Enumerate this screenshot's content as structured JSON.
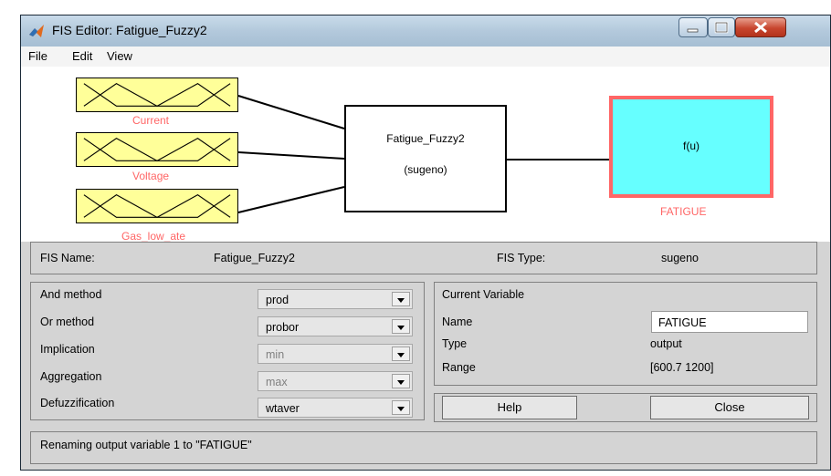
{
  "window": {
    "title": "FIS Editor: Fatigue_Fuzzy2"
  },
  "menu": {
    "file": "File",
    "edit": "Edit",
    "view": "View"
  },
  "diagram": {
    "inputs": [
      "Current",
      "Voltage",
      "Gas_low_ate"
    ],
    "system_name": "Fatigue_Fuzzy2",
    "system_type": "(sugeno)",
    "output_func": "f(u)",
    "output_name": "FATIGUE"
  },
  "fis": {
    "name_label": "FIS Name:",
    "name_value": "Fatigue_Fuzzy2",
    "type_label": "FIS Type:",
    "type_value": "sugeno"
  },
  "methods": {
    "and_label": "And method",
    "and_value": "prod",
    "or_label": "Or method",
    "or_value": "probor",
    "imp_label": "Implication",
    "imp_value": "min",
    "agg_label": "Aggregation",
    "agg_value": "max",
    "defuzz_label": "Defuzzification",
    "defuzz_value": "wtaver"
  },
  "current_variable": {
    "header": "Current Variable",
    "name_label": "Name",
    "name_value": "FATIGUE",
    "type_label": "Type",
    "type_value": "output",
    "range_label": "Range",
    "range_value": "[600.7 1200]"
  },
  "buttons": {
    "help": "Help",
    "close": "Close"
  },
  "status": {
    "text": "Renaming output variable 1 to \"FATIGUE\""
  },
  "colors": {
    "input_fill": "#ffff99",
    "output_fill": "#66ffff",
    "accent": "#ff6666"
  }
}
